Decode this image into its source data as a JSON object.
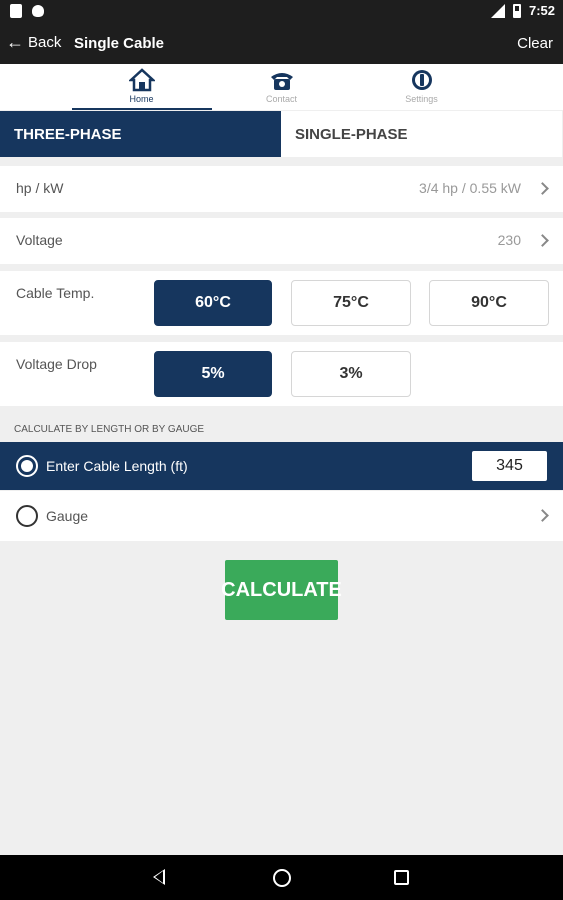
{
  "status_bar": {
    "time": "7:52",
    "icons": [
      "notification-icon",
      "apple-icon",
      "signal-icon",
      "battery-icon"
    ]
  },
  "app_bar": {
    "back_label": "Back",
    "title": "Single Cable",
    "clear_label": "Clear"
  },
  "nav_tabs": [
    {
      "label": "Home",
      "icon": "home-icon",
      "active": true
    },
    {
      "label": "Contact",
      "icon": "phone-icon",
      "active": false
    },
    {
      "label": "Settings",
      "icon": "settings-icon",
      "active": false
    }
  ],
  "phase_tabs": [
    {
      "label": "THREE-PHASE",
      "active": true
    },
    {
      "label": "SINGLE-PHASE",
      "active": false
    }
  ],
  "hp_row": {
    "label": "hp / kW",
    "value": "3/4 hp / 0.55 kW"
  },
  "voltage_row": {
    "label": "Voltage",
    "value": "230"
  },
  "cable_temp": {
    "label": "Cable Temp.",
    "options": [
      "60°C",
      "75°C",
      "90°C"
    ],
    "selected": "60°C"
  },
  "voltage_drop": {
    "label": "Voltage Drop",
    "options": [
      "5%",
      "3%"
    ],
    "selected": "5%"
  },
  "calc_section": {
    "header": "CALCULATE BY LENGTH OR BY GAUGE"
  },
  "length_option": {
    "label": "Enter Cable Length (ft)",
    "value": "345",
    "selected": true
  },
  "gauge_option": {
    "label": "Gauge",
    "selected": false
  },
  "calculate_button": {
    "label": "CALCULATE"
  },
  "colors": {
    "primary": "#16365e",
    "accent": "#3aaa5a",
    "background": "#efefef"
  }
}
